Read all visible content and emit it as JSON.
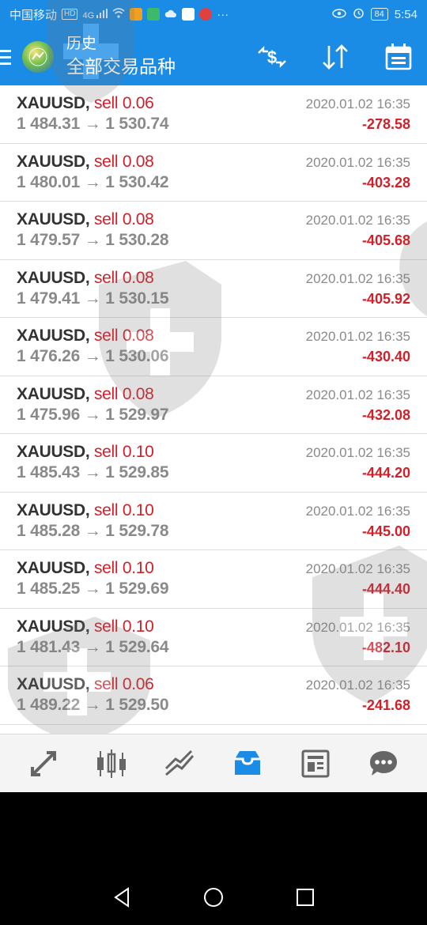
{
  "status_bar": {
    "carrier": "中国移动",
    "network_badge": "HD",
    "signal_text": "4G",
    "battery": "84",
    "time": "5:54",
    "more": "···"
  },
  "header": {
    "subtitle": "历史",
    "title": "全部交易品种",
    "actions": [
      "swap-currency-icon",
      "sort-icon",
      "calendar-icon"
    ]
  },
  "trades": [
    {
      "symbol": "XAUUSD,",
      "type": "sell 0.06",
      "open": "1 484.31",
      "close": "1 530.74",
      "time": "2020.01.02 16:35",
      "profit": "-278.58"
    },
    {
      "symbol": "XAUUSD,",
      "type": "sell 0.08",
      "open": "1 480.01",
      "close": "1 530.42",
      "time": "2020.01.02 16:35",
      "profit": "-403.28"
    },
    {
      "symbol": "XAUUSD,",
      "type": "sell 0.08",
      "open": "1 479.57",
      "close": "1 530.28",
      "time": "2020.01.02 16:35",
      "profit": "-405.68"
    },
    {
      "symbol": "XAUUSD,",
      "type": "sell 0.08",
      "open": "1 479.41",
      "close": "1 530.15",
      "time": "2020.01.02 16:35",
      "profit": "-405.92"
    },
    {
      "symbol": "XAUUSD,",
      "type": "sell 0.08",
      "open": "1 476.26",
      "close": "1 530.06",
      "time": "2020.01.02 16:35",
      "profit": "-430.40"
    },
    {
      "symbol": "XAUUSD,",
      "type": "sell 0.08",
      "open": "1 475.96",
      "close": "1 529.97",
      "time": "2020.01.02 16:35",
      "profit": "-432.08"
    },
    {
      "symbol": "XAUUSD,",
      "type": "sell 0.10",
      "open": "1 485.43",
      "close": "1 529.85",
      "time": "2020.01.02 16:35",
      "profit": "-444.20"
    },
    {
      "symbol": "XAUUSD,",
      "type": "sell 0.10",
      "open": "1 485.28",
      "close": "1 529.78",
      "time": "2020.01.02 16:35",
      "profit": "-445.00"
    },
    {
      "symbol": "XAUUSD,",
      "type": "sell 0.10",
      "open": "1 485.25",
      "close": "1 529.69",
      "time": "2020.01.02 16:35",
      "profit": "-444.40"
    },
    {
      "symbol": "XAUUSD,",
      "type": "sell 0.10",
      "open": "1 481.43",
      "close": "1 529.64",
      "time": "2020.01.02 16:35",
      "profit": "-482.10"
    },
    {
      "symbol": "XAUUSD,",
      "type": "sell 0.06",
      "open": "1 489.22",
      "close": "1 529.50",
      "time": "2020.01.02 16:35",
      "profit": "-241.68"
    }
  ],
  "arrow": "→",
  "bottom_nav": [
    "quotes-icon",
    "chart-icon",
    "trade-icon",
    "history-icon",
    "news-icon",
    "chat-icon"
  ],
  "active_nav": "history-icon",
  "colors": {
    "header_bg": "#1a8ce5",
    "sell": "#d0202a",
    "profit_negative": "#d0202a",
    "active_nav": "#1a8ce5",
    "muted_text": "#8a8a8a"
  }
}
